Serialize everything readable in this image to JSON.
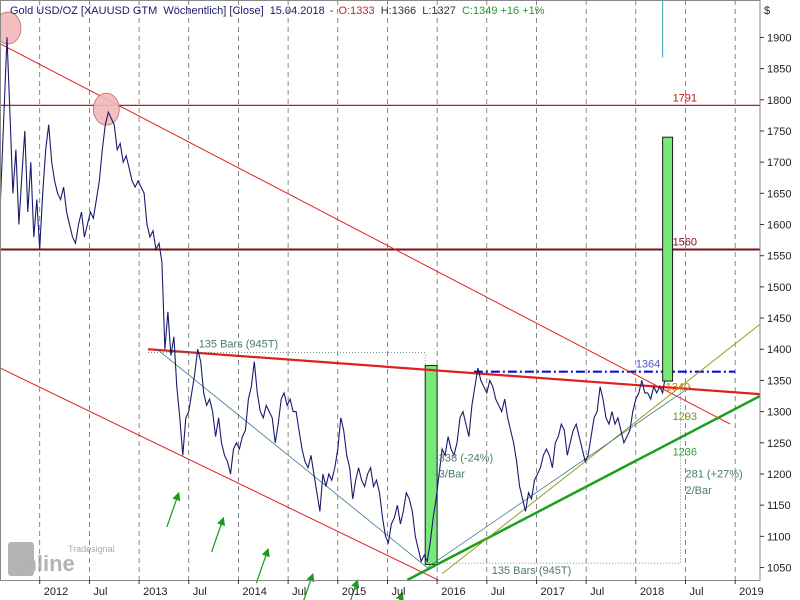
{
  "header": {
    "instrument": "Gold USD/OZ [XAUUSD GTM",
    "interval": "Wöchentlich] [Close]",
    "date": "15.04.2018",
    "open": "O:1333",
    "high": "H:1366",
    "low": "L:1327",
    "close_change": "C:1349 +16 +1%"
  },
  "watermark": {
    "line1": "Tradesignal",
    "line2": "online"
  },
  "currency_label": "$",
  "colors": {
    "price": "#1a1a6e",
    "resistance": "#e02020",
    "channel": "#e02020",
    "support": "#1aa01a",
    "thin_support": "#9a9a20",
    "level_dark": "#7a1010",
    "level_1791": "#c01818",
    "dotted_blue": "#1010d0",
    "green_box": "#78e878",
    "annotation_blue": "#5050c0",
    "annotation_gray": "#4a7a70",
    "annotation_olive": "#8a8a10",
    "annotation_green": "#30a030",
    "arrow": "#1a9a1a",
    "highlight": "#f2b8b8"
  },
  "annotations": {
    "bars_top": "135 Bars (945T)",
    "bars_bottom": "135 Bars (945T)",
    "pct_neg": "-338 (-24%)",
    "per_bar_neg": "-3/Bar",
    "pct_pos": "281 (+27%)",
    "per_bar_pos": "2/Bar",
    "level_1791": "1791",
    "level_1560": "1560",
    "level_1364": "1364",
    "level_1340": "1340",
    "level_1293": "1293",
    "level_1236": "1236"
  },
  "chart_data": {
    "type": "line",
    "title": "Gold USD/OZ [XAUUSD GTM Wöchentlich] [Close]",
    "xlabel": "",
    "ylabel": "$",
    "ylim": [
      1030,
      1960
    ],
    "y_ticks": [
      1050,
      1100,
      1150,
      1200,
      1250,
      1300,
      1350,
      1400,
      1450,
      1500,
      1550,
      1600,
      1650,
      1700,
      1750,
      1800,
      1850,
      1900
    ],
    "x_ticks": [
      {
        "t": 2012.0,
        "label": "2012"
      },
      {
        "t": 2012.5,
        "label": "Jul"
      },
      {
        "t": 2013.0,
        "label": "2013"
      },
      {
        "t": 2013.5,
        "label": "Jul"
      },
      {
        "t": 2014.0,
        "label": "2014"
      },
      {
        "t": 2014.5,
        "label": "Jul"
      },
      {
        "t": 2015.0,
        "label": "2015"
      },
      {
        "t": 2015.5,
        "label": "Jul"
      },
      {
        "t": 2016.0,
        "label": "2016"
      },
      {
        "t": 2016.5,
        "label": "Jul"
      },
      {
        "t": 2017.0,
        "label": "2017"
      },
      {
        "t": 2017.5,
        "label": "Jul"
      },
      {
        "t": 2018.0,
        "label": "2018"
      },
      {
        "t": 2018.5,
        "label": "Jul"
      },
      {
        "t": 2019.0,
        "label": "2019"
      }
    ],
    "xlim": [
      2011.6,
      2019.25
    ],
    "grid": true,
    "series": [
      {
        "values": [
          [
            2011.6,
            1620
          ],
          [
            2011.64,
            1780
          ],
          [
            2011.67,
            1900
          ],
          [
            2011.7,
            1780
          ],
          [
            2011.73,
            1650
          ],
          [
            2011.76,
            1720
          ],
          [
            2011.79,
            1600
          ],
          [
            2011.82,
            1680
          ],
          [
            2011.85,
            1750
          ],
          [
            2011.88,
            1620
          ],
          [
            2011.91,
            1700
          ],
          [
            2011.94,
            1580
          ],
          [
            2011.97,
            1640
          ],
          [
            2012.0,
            1560
          ],
          [
            2012.03,
            1650
          ],
          [
            2012.06,
            1720
          ],
          [
            2012.09,
            1760
          ],
          [
            2012.12,
            1700
          ],
          [
            2012.15,
            1670
          ],
          [
            2012.18,
            1650
          ],
          [
            2012.21,
            1640
          ],
          [
            2012.24,
            1660
          ],
          [
            2012.27,
            1620
          ],
          [
            2012.3,
            1600
          ],
          [
            2012.33,
            1580
          ],
          [
            2012.36,
            1570
          ],
          [
            2012.39,
            1600
          ],
          [
            2012.42,
            1620
          ],
          [
            2012.45,
            1580
          ],
          [
            2012.48,
            1600
          ],
          [
            2012.51,
            1620
          ],
          [
            2012.54,
            1610
          ],
          [
            2012.57,
            1640
          ],
          [
            2012.6,
            1670
          ],
          [
            2012.63,
            1720
          ],
          [
            2012.66,
            1760
          ],
          [
            2012.69,
            1780
          ],
          [
            2012.72,
            1770
          ],
          [
            2012.75,
            1760
          ],
          [
            2012.78,
            1720
          ],
          [
            2012.81,
            1730
          ],
          [
            2012.84,
            1700
          ],
          [
            2012.87,
            1710
          ],
          [
            2012.9,
            1690
          ],
          [
            2012.93,
            1670
          ],
          [
            2012.96,
            1660
          ],
          [
            2012.99,
            1670
          ],
          [
            2013.02,
            1660
          ],
          [
            2013.05,
            1650
          ],
          [
            2013.08,
            1600
          ],
          [
            2013.11,
            1580
          ],
          [
            2013.14,
            1590
          ],
          [
            2013.17,
            1560
          ],
          [
            2013.2,
            1570
          ],
          [
            2013.23,
            1540
          ],
          [
            2013.26,
            1400
          ],
          [
            2013.29,
            1460
          ],
          [
            2013.32,
            1390
          ],
          [
            2013.35,
            1420
          ],
          [
            2013.38,
            1340
          ],
          [
            2013.41,
            1290
          ],
          [
            2013.44,
            1230
          ],
          [
            2013.47,
            1290
          ],
          [
            2013.5,
            1300
          ],
          [
            2013.53,
            1330
          ],
          [
            2013.56,
            1360
          ],
          [
            2013.59,
            1400
          ],
          [
            2013.62,
            1380
          ],
          [
            2013.65,
            1330
          ],
          [
            2013.68,
            1310
          ],
          [
            2013.71,
            1320
          ],
          [
            2013.74,
            1300
          ],
          [
            2013.77,
            1260
          ],
          [
            2013.8,
            1290
          ],
          [
            2013.83,
            1250
          ],
          [
            2013.86,
            1230
          ],
          [
            2013.89,
            1220
          ],
          [
            2013.92,
            1200
          ],
          [
            2013.95,
            1240
          ],
          [
            2013.98,
            1250
          ],
          [
            2014.01,
            1240
          ],
          [
            2014.04,
            1260
          ],
          [
            2014.07,
            1270
          ],
          [
            2014.1,
            1320
          ],
          [
            2014.13,
            1340
          ],
          [
            2014.16,
            1380
          ],
          [
            2014.19,
            1330
          ],
          [
            2014.22,
            1300
          ],
          [
            2014.25,
            1290
          ],
          [
            2014.28,
            1310
          ],
          [
            2014.31,
            1300
          ],
          [
            2014.34,
            1290
          ],
          [
            2014.37,
            1250
          ],
          [
            2014.4,
            1280
          ],
          [
            2014.43,
            1320
          ],
          [
            2014.46,
            1330
          ],
          [
            2014.49,
            1310
          ],
          [
            2014.52,
            1320
          ],
          [
            2014.55,
            1300
          ],
          [
            2014.58,
            1300
          ],
          [
            2014.61,
            1270
          ],
          [
            2014.64,
            1240
          ],
          [
            2014.67,
            1220
          ],
          [
            2014.7,
            1210
          ],
          [
            2014.73,
            1230
          ],
          [
            2014.76,
            1200
          ],
          [
            2014.79,
            1170
          ],
          [
            2014.82,
            1140
          ],
          [
            2014.85,
            1200
          ],
          [
            2014.88,
            1180
          ],
          [
            2014.91,
            1200
          ],
          [
            2014.94,
            1190
          ],
          [
            2014.97,
            1210
          ],
          [
            2015.0,
            1240
          ],
          [
            2015.03,
            1290
          ],
          [
            2015.06,
            1270
          ],
          [
            2015.09,
            1230
          ],
          [
            2015.12,
            1210
          ],
          [
            2015.15,
            1160
          ],
          [
            2015.18,
            1190
          ],
          [
            2015.21,
            1210
          ],
          [
            2015.24,
            1190
          ],
          [
            2015.27,
            1180
          ],
          [
            2015.3,
            1200
          ],
          [
            2015.33,
            1210
          ],
          [
            2015.36,
            1180
          ],
          [
            2015.39,
            1190
          ],
          [
            2015.42,
            1170
          ],
          [
            2015.45,
            1130
          ],
          [
            2015.48,
            1100
          ],
          [
            2015.51,
            1090
          ],
          [
            2015.54,
            1120
          ],
          [
            2015.57,
            1130
          ],
          [
            2015.6,
            1150
          ],
          [
            2015.63,
            1120
          ],
          [
            2015.66,
            1140
          ],
          [
            2015.69,
            1170
          ],
          [
            2015.72,
            1160
          ],
          [
            2015.75,
            1140
          ],
          [
            2015.78,
            1100
          ],
          [
            2015.81,
            1080
          ],
          [
            2015.84,
            1060
          ],
          [
            2015.87,
            1070
          ],
          [
            2015.9,
            1060
          ],
          [
            2015.93,
            1090
          ],
          [
            2015.96,
            1130
          ],
          [
            2015.99,
            1160
          ],
          [
            2016.02,
            1200
          ],
          [
            2016.05,
            1240
          ],
          [
            2016.08,
            1230
          ],
          [
            2016.11,
            1260
          ],
          [
            2016.14,
            1240
          ],
          [
            2016.17,
            1230
          ],
          [
            2016.2,
            1250
          ],
          [
            2016.23,
            1290
          ],
          [
            2016.26,
            1300
          ],
          [
            2016.29,
            1280
          ],
          [
            2016.32,
            1260
          ],
          [
            2016.35,
            1310
          ],
          [
            2016.38,
            1340
          ],
          [
            2016.41,
            1370
          ],
          [
            2016.44,
            1350
          ],
          [
            2016.47,
            1340
          ],
          [
            2016.5,
            1330
          ],
          [
            2016.53,
            1350
          ],
          [
            2016.56,
            1340
          ],
          [
            2016.59,
            1320
          ],
          [
            2016.62,
            1310
          ],
          [
            2016.65,
            1300
          ],
          [
            2016.68,
            1320
          ],
          [
            2016.71,
            1290
          ],
          [
            2016.74,
            1270
          ],
          [
            2016.77,
            1250
          ],
          [
            2016.8,
            1220
          ],
          [
            2016.83,
            1180
          ],
          [
            2016.86,
            1160
          ],
          [
            2016.89,
            1140
          ],
          [
            2016.92,
            1170
          ],
          [
            2016.95,
            1160
          ],
          [
            2016.98,
            1190
          ],
          [
            2017.01,
            1200
          ],
          [
            2017.04,
            1210
          ],
          [
            2017.07,
            1230
          ],
          [
            2017.1,
            1240
          ],
          [
            2017.13,
            1230
          ],
          [
            2017.16,
            1210
          ],
          [
            2017.19,
            1250
          ],
          [
            2017.22,
            1260
          ],
          [
            2017.25,
            1280
          ],
          [
            2017.28,
            1270
          ],
          [
            2017.31,
            1230
          ],
          [
            2017.34,
            1250
          ],
          [
            2017.37,
            1270
          ],
          [
            2017.4,
            1280
          ],
          [
            2017.43,
            1260
          ],
          [
            2017.46,
            1240
          ],
          [
            2017.49,
            1220
          ],
          [
            2017.52,
            1230
          ],
          [
            2017.55,
            1260
          ],
          [
            2017.58,
            1290
          ],
          [
            2017.61,
            1300
          ],
          [
            2017.64,
            1340
          ],
          [
            2017.67,
            1320
          ],
          [
            2017.7,
            1290
          ],
          [
            2017.73,
            1280
          ],
          [
            2017.76,
            1300
          ],
          [
            2017.79,
            1280
          ],
          [
            2017.82,
            1290
          ],
          [
            2017.85,
            1270
          ],
          [
            2017.88,
            1250
          ],
          [
            2017.91,
            1260
          ],
          [
            2017.94,
            1270
          ],
          [
            2017.97,
            1300
          ],
          [
            2018.0,
            1320
          ],
          [
            2018.03,
            1330
          ],
          [
            2018.06,
            1350
          ],
          [
            2018.09,
            1330
          ],
          [
            2018.12,
            1330
          ],
          [
            2018.15,
            1320
          ],
          [
            2018.18,
            1340
          ],
          [
            2018.21,
            1330
          ],
          [
            2018.24,
            1340
          ],
          [
            2018.27,
            1330
          ],
          [
            2018.29,
            1349
          ]
        ]
      }
    ],
    "lines": [
      {
        "name": "resistance",
        "from": [
          2013.09,
          1400
        ],
        "to": [
          2019.25,
          1328
        ]
      },
      {
        "name": "upper_channel",
        "from": [
          2011.6,
          1890
        ],
        "to": [
          2018.95,
          1280
        ]
      },
      {
        "name": "lower_channel",
        "from": [
          2011.6,
          1370
        ],
        "to": [
          2016.4,
          1000
        ]
      },
      {
        "name": "green_support",
        "from": [
          2015.7,
          1030
        ],
        "to": [
          2019.25,
          1325
        ]
      },
      {
        "name": "olive_support",
        "from": [
          2016.05,
          1040
        ],
        "to": [
          2019.25,
          1440
        ]
      },
      {
        "name": "teal_diag1",
        "from": [
          2013.18,
          1400
        ],
        "to": [
          2015.9,
          1050
        ]
      },
      {
        "name": "teal_diag2",
        "from": [
          2015.9,
          1050
        ],
        "to": [
          2018.55,
          1340
        ]
      }
    ],
    "levels": [
      {
        "value": 1791
      },
      {
        "value": 1560
      },
      {
        "value": 1364
      }
    ],
    "boxes": [
      {
        "x0": 2015.88,
        "x1": 2016.0,
        "y0": 1055,
        "y1": 1374
      },
      {
        "x0": 2018.27,
        "x1": 2018.37,
        "y0": 1349,
        "y1": 1740
      }
    ]
  }
}
